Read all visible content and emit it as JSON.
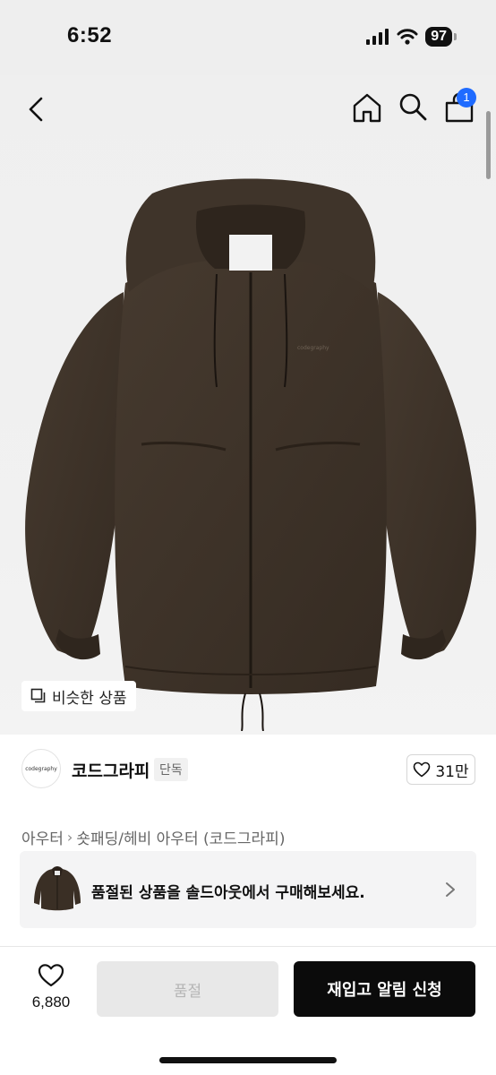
{
  "status_bar": {
    "time": "6:52",
    "battery": "97"
  },
  "nav": {
    "cart_badge": "1"
  },
  "hero": {
    "similar_label": "비슷한 상품",
    "product_logo_text": "codegraphy"
  },
  "brand": {
    "logo_text": "codegraphy",
    "name": "코드그라피",
    "tag": "단독",
    "likes": "31만"
  },
  "breadcrumb": {
    "category": "아우터",
    "subcategory": "숏패딩/헤비 아우터 (코드그라피)"
  },
  "soldout_banner": {
    "text": "품절된 상품을 솔드아웃에서 구매해보세요."
  },
  "bottom_bar": {
    "wish_count": "6,880",
    "soldout_label": "품절",
    "restock_label": "재입고 알림 신청"
  },
  "colors": {
    "accent": "#1f6bff",
    "jacket": "#3d3228",
    "primary_button": "#0b0b0b"
  },
  "icons": [
    "back-icon",
    "home-icon",
    "search-icon",
    "cart-icon",
    "similar-icon",
    "heart-icon",
    "chevron-right-icon"
  ]
}
